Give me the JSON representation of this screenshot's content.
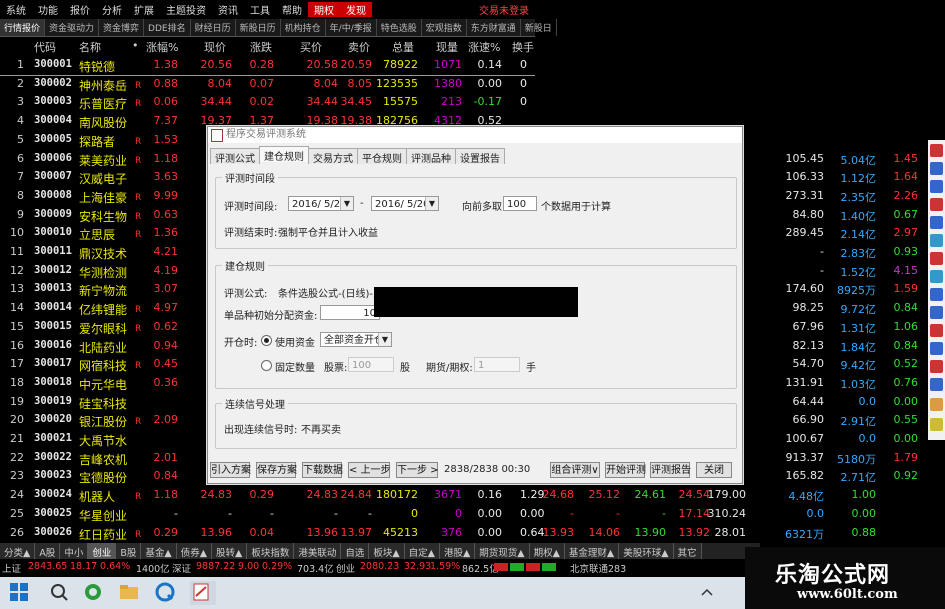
{
  "menu": {
    "items": [
      "系统",
      "功能",
      "报价",
      "分析",
      "扩展",
      "主题投资",
      "资讯",
      "工具",
      "帮助",
      "期权",
      "发现"
    ],
    "right_label": "交易未登录"
  },
  "market_tabs": [
    "行情报价",
    "资金驱动力",
    "资金博弈",
    "DDE排名",
    "财经日历",
    "新股日历",
    "机构持仓",
    "年/中/季报",
    "特色选股",
    "宏观指数",
    "东方财富通",
    "新股日"
  ],
  "columns": [
    "代码",
    "名称",
    "涨幅%",
    "现价",
    "涨跌",
    "买价",
    "卖价",
    "总量",
    "现量",
    "涨速%",
    "换手"
  ],
  "rows": [
    {
      "idx": "1",
      "code": "300001",
      "name": "特锐德",
      "r": "",
      "chg": "1.38",
      "price": "20.56",
      "diff": "0.28",
      "buy": "20.58",
      "sell": "20.59",
      "vol": "78922",
      "cur": "1071",
      "spd": "0.14",
      "sep": "0",
      "ext": []
    },
    {
      "idx": "2",
      "code": "300002",
      "name": "神州泰岳",
      "r": "R",
      "chg": "0.88",
      "price": "8.04",
      "diff": "0.07",
      "buy": "8.04",
      "sell": "8.05",
      "vol": "123535",
      "cur": "1380",
      "spd": "0.00",
      "sep": "0",
      "ext": []
    },
    {
      "idx": "3",
      "code": "300003",
      "name": "乐普医疗",
      "r": "R",
      "chg": "0.06",
      "price": "34.44",
      "diff": "0.02",
      "buy": "34.44",
      "sell": "34.45",
      "vol": "15575",
      "cur": "213",
      "spd": "-0.17",
      "sep": "0",
      "ext": []
    },
    {
      "idx": "4",
      "code": "300004",
      "name": "南风股份",
      "r": "",
      "chg": "7.37",
      "price": "19.37",
      "diff": "1.37",
      "buy": "19.38",
      "sell": "19.38",
      "vol": "182756",
      "cur": "4312",
      "spd": "0.52",
      "sep": "",
      "ext": []
    },
    {
      "idx": "5",
      "code": "300005",
      "name": "探路者",
      "r": "R",
      "chg": "1.53",
      "price": "",
      "diff": "",
      "buy": "",
      "sell": "",
      "vol": "",
      "cur": "",
      "spd": "",
      "sep": "",
      "ext": []
    },
    {
      "idx": "6",
      "code": "300006",
      "name": "莱美药业",
      "r": "R",
      "chg": "1.18",
      "price": "",
      "diff": "",
      "buy": "",
      "sell": "",
      "vol": "",
      "cur": "",
      "spd": "",
      "sep": "",
      "ext": [
        "105.45",
        "5.04亿",
        "1.45"
      ]
    },
    {
      "idx": "7",
      "code": "300007",
      "name": "汉威电子",
      "r": "",
      "chg": "3.63",
      "price": "",
      "diff": "",
      "buy": "",
      "sell": "",
      "vol": "",
      "cur": "",
      "spd": "",
      "sep": "",
      "ext": [
        "106.33",
        "1.12亿",
        "1.64"
      ]
    },
    {
      "idx": "8",
      "code": "300008",
      "name": "上海佳豪",
      "r": "R",
      "chg": "9.99",
      "price": "",
      "diff": "",
      "buy": "",
      "sell": "",
      "vol": "",
      "cur": "",
      "spd": "",
      "sep": "",
      "ext": [
        "273.31",
        "2.35亿",
        "2.26"
      ]
    },
    {
      "idx": "9",
      "code": "300009",
      "name": "安科生物",
      "r": "R",
      "chg": "0.63",
      "price": "",
      "diff": "",
      "buy": "",
      "sell": "",
      "vol": "",
      "cur": "",
      "spd": "",
      "sep": "",
      "ext": [
        "84.80",
        "1.40亿",
        "0.67"
      ]
    },
    {
      "idx": "10",
      "code": "300010",
      "name": "立思辰",
      "r": "R",
      "chg": "1.36",
      "price": "",
      "diff": "",
      "buy": "",
      "sell": "",
      "vol": "",
      "cur": "",
      "spd": "",
      "sep": "",
      "ext": [
        "289.45",
        "2.14亿",
        "2.97"
      ]
    },
    {
      "idx": "11",
      "code": "300011",
      "name": "鼎汉技术",
      "r": "",
      "chg": "4.21",
      "price": "",
      "diff": "",
      "buy": "",
      "sell": "",
      "vol": "",
      "cur": "",
      "spd": "",
      "sep": "",
      "ext": [
        "-",
        "2.83亿",
        "0.93"
      ]
    },
    {
      "idx": "12",
      "code": "300012",
      "name": "华测检测",
      "r": "",
      "chg": "4.19",
      "price": "",
      "diff": "",
      "buy": "",
      "sell": "",
      "vol": "",
      "cur": "",
      "spd": "",
      "sep": "",
      "ext": [
        "-",
        "1.52亿",
        "4.15"
      ]
    },
    {
      "idx": "13",
      "code": "300013",
      "name": "新宁物流",
      "r": "",
      "chg": "3.07",
      "price": "",
      "diff": "",
      "buy": "",
      "sell": "",
      "vol": "",
      "cur": "",
      "spd": "",
      "sep": "",
      "ext": [
        "174.60",
        "8925万",
        "1.59"
      ]
    },
    {
      "idx": "14",
      "code": "300014",
      "name": "亿纬锂能",
      "r": "R",
      "chg": "4.97",
      "price": "",
      "diff": "",
      "buy": "",
      "sell": "",
      "vol": "",
      "cur": "",
      "spd": "",
      "sep": "",
      "ext": [
        "98.25",
        "9.72亿",
        "0.84"
      ]
    },
    {
      "idx": "15",
      "code": "300015",
      "name": "爱尔眼科",
      "r": "R",
      "chg": "0.62",
      "price": "",
      "diff": "",
      "buy": "",
      "sell": "",
      "vol": "",
      "cur": "",
      "spd": "",
      "sep": "",
      "ext": [
        "67.96",
        "1.31亿",
        "1.06"
      ]
    },
    {
      "idx": "16",
      "code": "300016",
      "name": "北陆药业",
      "r": "",
      "chg": "0.94",
      "price": "",
      "diff": "",
      "buy": "",
      "sell": "",
      "vol": "",
      "cur": "",
      "spd": "",
      "sep": "",
      "ext": [
        "82.13",
        "1.84亿",
        "0.84"
      ]
    },
    {
      "idx": "17",
      "code": "300017",
      "name": "网宿科技",
      "r": "R",
      "chg": "0.45",
      "price": "",
      "diff": "",
      "buy": "",
      "sell": "",
      "vol": "",
      "cur": "",
      "spd": "",
      "sep": "",
      "ext": [
        "54.70",
        "9.42亿",
        "0.52"
      ]
    },
    {
      "idx": "18",
      "code": "300018",
      "name": "中元华电",
      "r": "",
      "chg": "0.36",
      "price": "",
      "diff": "",
      "buy": "",
      "sell": "",
      "vol": "",
      "cur": "",
      "spd": "",
      "sep": "",
      "ext": [
        "131.91",
        "1.03亿",
        "0.76"
      ]
    },
    {
      "idx": "19",
      "code": "300019",
      "name": "硅宝科技",
      "r": "",
      "chg": "",
      "price": "",
      "diff": "",
      "buy": "",
      "sell": "",
      "vol": "",
      "cur": "",
      "spd": "",
      "sep": "",
      "ext": [
        "64.44",
        "0.0",
        "0.00"
      ]
    },
    {
      "idx": "20",
      "code": "300020",
      "name": "银江股份",
      "r": "R",
      "chg": "2.09",
      "price": "",
      "diff": "",
      "buy": "",
      "sell": "",
      "vol": "",
      "cur": "",
      "spd": "",
      "sep": "",
      "ext": [
        "66.90",
        "2.91亿",
        "0.55"
      ]
    },
    {
      "idx": "21",
      "code": "300021",
      "name": "大禹节水",
      "r": "",
      "chg": "",
      "price": "",
      "diff": "",
      "buy": "",
      "sell": "",
      "vol": "",
      "cur": "",
      "spd": "",
      "sep": "",
      "ext": [
        "100.67",
        "0.0",
        "0.00"
      ]
    },
    {
      "idx": "22",
      "code": "300022",
      "name": "吉峰农机",
      "r": "",
      "chg": "2.01",
      "price": "",
      "diff": "",
      "buy": "",
      "sell": "",
      "vol": "",
      "cur": "",
      "spd": "",
      "sep": "",
      "ext": [
        "913.37",
        "5180万",
        "1.79"
      ]
    },
    {
      "idx": "23",
      "code": "300023",
      "name": "宝德股份",
      "r": "",
      "chg": "0.84",
      "price": "",
      "diff": "",
      "buy": "",
      "sell": "",
      "vol": "",
      "cur": "",
      "spd": "",
      "sep": "",
      "ext": [
        "165.82",
        "2.71亿",
        "0.92"
      ]
    },
    {
      "idx": "24",
      "code": "300024",
      "name": "机器人",
      "r": "R",
      "chg": "1.18",
      "price": "24.83",
      "diff": "0.29",
      "buy": "24.83",
      "sell": "24.84",
      "vol": "180172",
      "cur": "3671",
      "spd": "0.16",
      "sep": "1.29",
      "ext": [
        "24.68",
        "25.12",
        "24.61",
        "24.54",
        "179.00",
        "4.48亿",
        "1.00"
      ]
    },
    {
      "idx": "25",
      "code": "300025",
      "name": "华星创业",
      "r": "",
      "chg": "-",
      "price": "-",
      "diff": "-",
      "buy": "-",
      "sell": "-",
      "vol": "0",
      "cur": "0",
      "spd": "0.00",
      "sep": "0.00",
      "ext": [
        "-",
        "-",
        "-",
        "17.14",
        "310.24",
        "0.0",
        "0.00"
      ]
    },
    {
      "idx": "26",
      "code": "300026",
      "name": "红日药业",
      "r": "R",
      "chg": "0.29",
      "price": "13.96",
      "diff": "0.04",
      "buy": "13.96",
      "sell": "13.97",
      "vol": "45213",
      "cur": "376",
      "spd": "0.00",
      "sep": "0.64",
      "ext": [
        "13.93",
        "14.06",
        "13.90",
        "13.92",
        "28.01",
        "6321万",
        "0.88"
      ]
    }
  ],
  "bottom_tabs": [
    "分类▲",
    "A股",
    "中小",
    "创业",
    "B股",
    "基金▲",
    "债券▲",
    "股转▲",
    "板块指数",
    "港美联动",
    "自选",
    "板块▲",
    "自定▲",
    "港股▲",
    "期货现货▲",
    "期权▲",
    "基金理财▲",
    "美股环球▲",
    "其它"
  ],
  "status": {
    "sh_label": "上证",
    "sh_val": "2843.65",
    "sh_diff": "18.17",
    "sh_pct": "0.64%",
    "sh_amt": "1400亿",
    "sz_label": "深证",
    "sz_val": "9887.22",
    "sz_diff": "9.00",
    "sz_pct": "0.29%",
    "sz_amt": "703.4亿",
    "cy_label": "创业",
    "cy_val": "2080.23",
    "cy_diff": "32.93",
    "cy_pct": "1.59%",
    "cy_amt": "862.5亿",
    "conn": "北京联通283"
  },
  "dialog": {
    "title": "程序交易评测系统",
    "tabs": [
      "评测公式",
      "建仓规则",
      "交易方式",
      "平仓规则",
      "评测品种",
      "设置报告"
    ],
    "active_tab": "建仓规则",
    "period_group": "评测时间段",
    "period_label": "评测时间段:",
    "date_from": "2016/ 5/20",
    "date_to": "2016/ 5/20",
    "forward_label": "向前多取",
    "forward_value": "100",
    "forward_suffix": "个数据用于计算",
    "end_label": "评测结束时:",
    "end_value": "强制平仓并且计入收益",
    "build_group": "建仓规则",
    "formula_label": "评测公式:",
    "formula_value": "条件选股公式-(日线)-贝塔反弹(0.65)",
    "alloc_label": "单品种初始分配资金:",
    "alloc_value": "10",
    "open_label": "开仓时:",
    "use_funds_label": "使用资金",
    "use_funds_option": "全部资金开仓",
    "fixed_qty_label": "固定数量",
    "stock_label": "股票:",
    "stock_value": "100",
    "stock_unit": "股",
    "futures_label": "期货/期权:",
    "futures_value": "1",
    "futures_unit": "手",
    "cont_group": "连续信号处理",
    "cont_label": "出现连续信号时:",
    "cont_value": "不再买卖",
    "buttons": [
      "引入方案",
      "保存方案",
      "下载数据",
      "< 上一步",
      "下一步 >",
      "组合评测∨",
      "开始评测",
      "评测报告",
      "关闭"
    ],
    "progress": "2838/2838 00:30"
  },
  "watermark": {
    "line1": "乐淘公式网",
    "line2": "www.60lt.com"
  }
}
